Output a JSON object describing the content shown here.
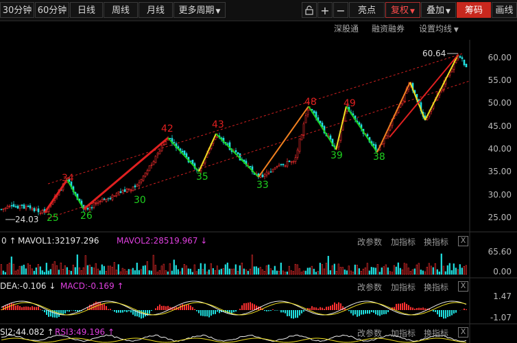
{
  "toolbar": {
    "periods": [
      "30分钟",
      "60分钟",
      "日线",
      "周线",
      "月线",
      "更多周期"
    ],
    "zoom_in": "+",
    "zoom_out": "−",
    "highlight": "亮点",
    "adjust": "复权",
    "overlay": "叠加",
    "chips": "筹码",
    "draw": "画线"
  },
  "subbar": {
    "connect": "深股通",
    "margin": "融资融券",
    "ma_settings": "设置均线"
  },
  "price_chart": {
    "y_ticks": [
      "60.00",
      "55.00",
      "50.00",
      "45.00",
      "40.00",
      "35.00",
      "30.00",
      "25.00"
    ],
    "high_label": "60.64",
    "low_label": "24.03",
    "peaks": [
      "34",
      "42",
      "43",
      "48",
      "49"
    ],
    "troughs": [
      "25",
      "26",
      "30",
      "35",
      "33",
      "39",
      "38"
    ],
    "colors": {
      "peak": "#e02020",
      "trough": "#1fd01f",
      "up": "#ff3030",
      "down": "#20e0e0"
    }
  },
  "volume_panel": {
    "label_prefix": "0 ↑",
    "mavol1": "MAVOL1:32197.296",
    "mavol2": "MAVOL2:28519.967 ↓",
    "change_params": "改参数",
    "add_indicator": "加指标",
    "switch_indicator": "换指标",
    "close": "X",
    "y_ticks": [
      "65.60",
      "0.00"
    ]
  },
  "macd_panel": {
    "dea": "DEA:-0.106 ↓",
    "macd": "MACD:-0.169 ↑",
    "change_params": "改参数",
    "add_indicator": "加指标",
    "switch_indicator": "换指标",
    "close": "X",
    "y_ticks": [
      "1.47",
      "-1.07"
    ]
  },
  "rsi_panel": {
    "rsi2": "SI2:44.082 ↑",
    "rsi3": "RSI3:49.196 ↑",
    "change_params": "改参数",
    "add_indicator": "加指标",
    "switch_indicator": "换指标",
    "close": "X"
  }
}
